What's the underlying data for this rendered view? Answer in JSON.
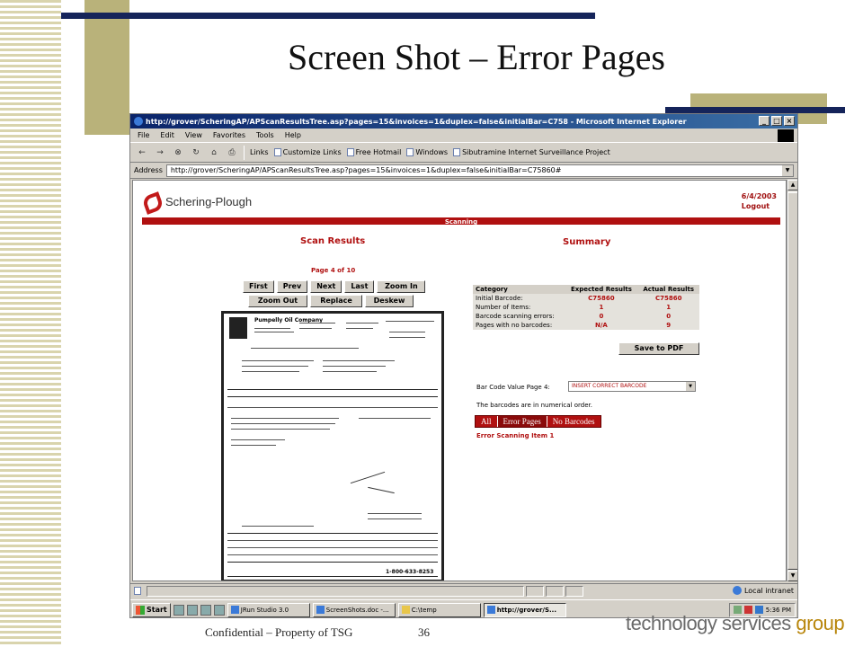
{
  "slide": {
    "title": "Screen Shot – Error Pages",
    "footer_left": "Confidential – Property of TSG",
    "page_number": "36",
    "brand_main": "technology services ",
    "brand_accent": "group"
  },
  "colors": {
    "accent_red": "#b01010",
    "slide_navy": "#15245a",
    "slide_olive": "#b9b27a"
  },
  "browser": {
    "window_title": "http://grover/ScheringAP/APScanResultsTree.asp?pages=15&invoices=1&duplex=false&initialBar=C758 - Microsoft Internet Explorer",
    "menu": [
      "File",
      "Edit",
      "View",
      "Favorites",
      "Tools",
      "Help"
    ],
    "links_label": "Links",
    "links": [
      "Customize Links",
      "Free Hotmail",
      "Windows",
      "Sibutramine Internet Surveillance Project"
    ],
    "address_label": "Address",
    "address_url": "http://grover/ScheringAP/APScanResultsTree.asp?pages=15&invoices=1&duplex=false&initialBar=C75860#",
    "status_zone": "Local intranet"
  },
  "page": {
    "company": "Schering-Plough",
    "date": "6/4/2003",
    "logout": "Logout",
    "section": "Scanning",
    "scan_results_heading": "Scan Results",
    "summary_heading": "Summary",
    "page_of": "Page 4 of 10",
    "nav_row1": [
      "First",
      "Prev",
      "Next",
      "Last",
      "Zoom In"
    ],
    "nav_row2": [
      "Zoom Out",
      "Replace",
      "Deskew"
    ],
    "doc_company": "Pumpelly Oil Company",
    "doc_phone": "1-800-633-8253",
    "summary_headers": [
      "Category",
      "Expected Results",
      "Actual Results"
    ],
    "summary_rows": [
      [
        "Initial Barcode:",
        "C75860",
        "C75860"
      ],
      [
        "Number of Items:",
        "1",
        "1"
      ],
      [
        "Barcode scanning errors:",
        "0",
        "0"
      ],
      [
        "Pages with no barcodes:",
        "N/A",
        "9"
      ]
    ],
    "save_pdf": "Save to PDF",
    "barcode_label": "Bar Code Value Page  4:",
    "barcode_select": "INSERT CORRECT BARCODE",
    "order_note": "The barcodes are in numerical order.",
    "tabs": [
      "All",
      "Error Pages",
      "No Barcodes"
    ],
    "active_tab": "Error Pages",
    "error_item": "Error Scanning Item 1"
  },
  "taskbar": {
    "start": "Start",
    "tasks": [
      "JRun Studio 3.0",
      "ScreenShots.doc -...",
      "C:\\temp",
      "http://grover/S..."
    ],
    "active_task": "http://grover/S...",
    "clock": "5:36 PM"
  }
}
